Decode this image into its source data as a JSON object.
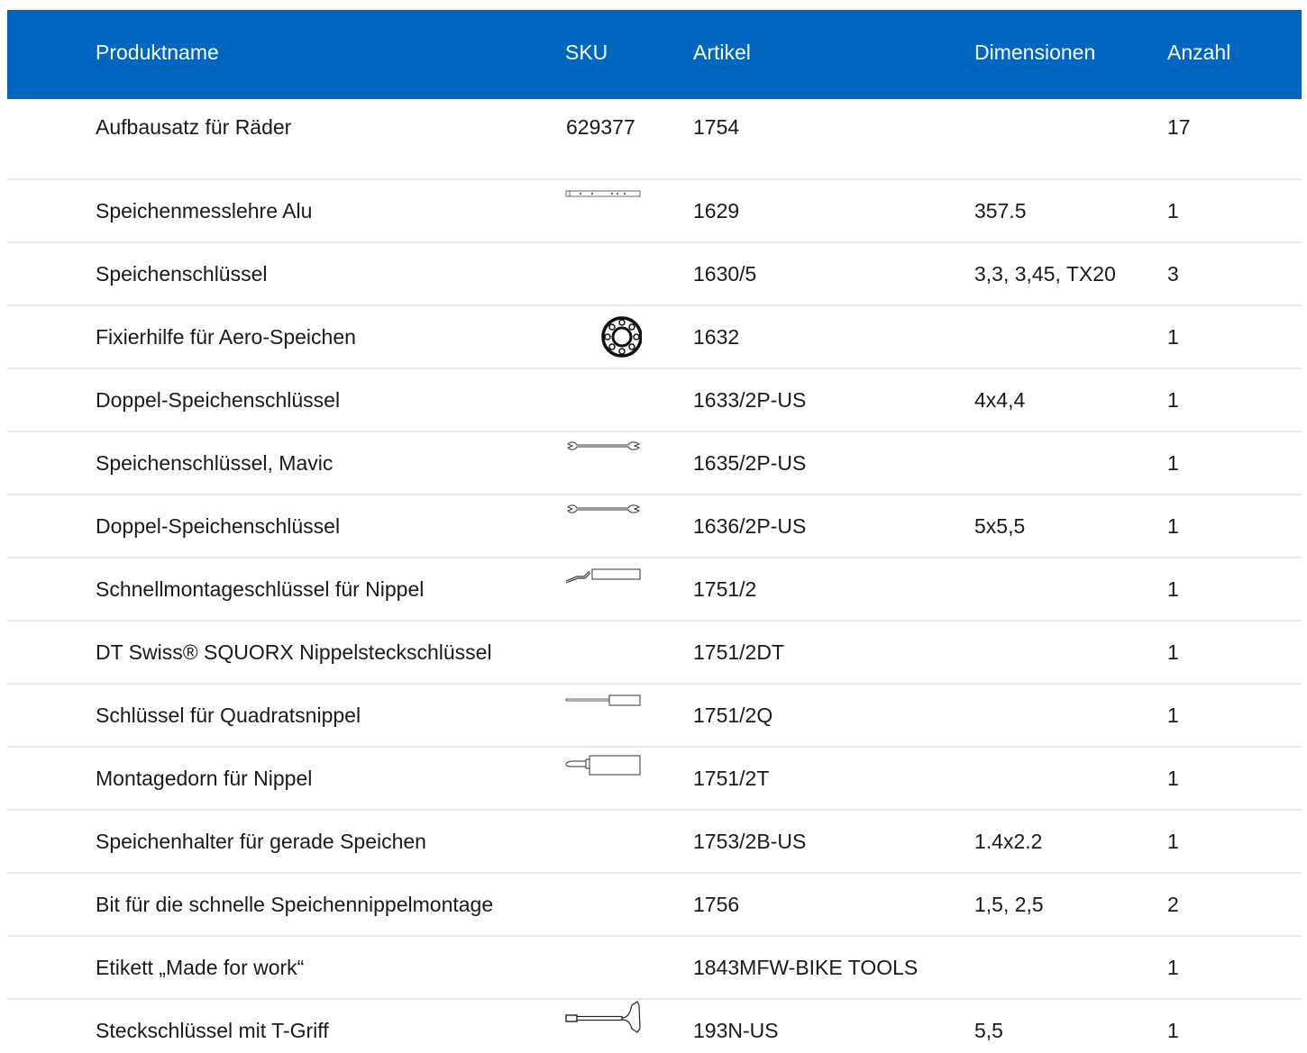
{
  "header": {
    "name": "Produktname",
    "sku": "SKU",
    "article": "Artikel",
    "dimensions": "Dimensionen",
    "quantity": "Anzahl"
  },
  "rows": [
    {
      "name": "Aufbausatz für Räder",
      "sku": "629377",
      "article": "1754",
      "dimensions": "",
      "quantity": "17",
      "icon": ""
    },
    {
      "name": "Speichenmesslehre Alu",
      "sku": "",
      "article": "1629",
      "dimensions": "357.5",
      "quantity": "1",
      "icon": "spoke-gauge-icon"
    },
    {
      "name": "Speichenschlüssel",
      "sku": "",
      "article": "1630/5",
      "dimensions": "3,3, 3,45, TX20",
      "quantity": "3",
      "icon": ""
    },
    {
      "name": "Fixierhilfe für Aero-Speichen",
      "sku": "",
      "article": "1632",
      "dimensions": "",
      "quantity": "1",
      "icon": "aero-spoke-holder-icon"
    },
    {
      "name": "Doppel-Speichenschlüssel",
      "sku": "",
      "article": "1633/2P-US",
      "dimensions": "4x4,4",
      "quantity": "1",
      "icon": ""
    },
    {
      "name": "Speichenschlüssel, Mavic",
      "sku": "",
      "article": "1635/2P-US",
      "dimensions": "",
      "quantity": "1",
      "icon": "double-end-wrench-icon"
    },
    {
      "name": "Doppel-Speichenschlüssel",
      "sku": "",
      "article": "1636/2P-US",
      "dimensions": "5x5,5",
      "quantity": "1",
      "icon": "double-end-wrench-icon"
    },
    {
      "name": "Schnellmontageschlüssel für Nippel",
      "sku": "",
      "article": "1751/2",
      "dimensions": "",
      "quantity": "1",
      "icon": "bent-nipple-driver-icon"
    },
    {
      "name": "DT Swiss® SQUORX Nippelsteckschlüssel",
      "sku": "",
      "article": "1751/2DT",
      "dimensions": "",
      "quantity": "1",
      "icon": ""
    },
    {
      "name": "Schlüssel für Quadratsnippel",
      "sku": "",
      "article": "1751/2Q",
      "dimensions": "",
      "quantity": "1",
      "icon": "square-nipple-driver-icon"
    },
    {
      "name": "Montagedorn für Nippel",
      "sku": "",
      "article": "1751/2T",
      "dimensions": "",
      "quantity": "1",
      "icon": "nipple-mandrel-icon"
    },
    {
      "name": "Speichenhalter für gerade Speichen",
      "sku": "",
      "article": "1753/2B-US",
      "dimensions": "1.4x2.2",
      "quantity": "1",
      "icon": ""
    },
    {
      "name": "Bit für die schnelle Speichennippelmontage",
      "sku": "",
      "article": "1756",
      "dimensions": "1,5, 2,5",
      "quantity": "2",
      "icon": ""
    },
    {
      "name": "Etikett „Made for work“",
      "sku": "",
      "article": "1843MFW-BIKE TOOLS",
      "dimensions": "",
      "quantity": "1",
      "icon": ""
    },
    {
      "name": "Steckschlüssel mit T-Griff",
      "sku": "",
      "article": "193N-US",
      "dimensions": "5,5",
      "quantity": "1",
      "icon": "t-handle-socket-wrench-icon"
    }
  ]
}
